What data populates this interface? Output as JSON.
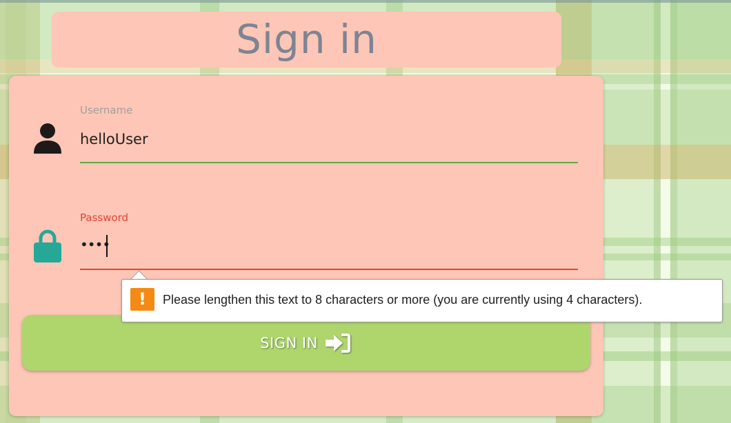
{
  "page": {
    "title": "Sign in"
  },
  "form": {
    "username": {
      "label": "Username",
      "value": "helloUser",
      "icon": "user-icon",
      "label_color": "#9f9f9f",
      "underline_color": "#5bab4a"
    },
    "password": {
      "label": "Password",
      "value": "••••",
      "icon": "lock-icon",
      "label_color": "#e04535",
      "underline_color": "#e04535"
    },
    "validation": {
      "message": "Please lengthen this text to 8 characters or more (you are currently using 4 characters).",
      "icon": "warning-icon",
      "icon_symbol": "!"
    },
    "submit": {
      "label": "SIGN IN",
      "icon": "sign-in-icon"
    }
  },
  "colors": {
    "card": "#fec6b6",
    "title_text": "#7d8494",
    "button": "#aed66d",
    "lock_icon": "#25a898",
    "warning": "#f48a13"
  }
}
